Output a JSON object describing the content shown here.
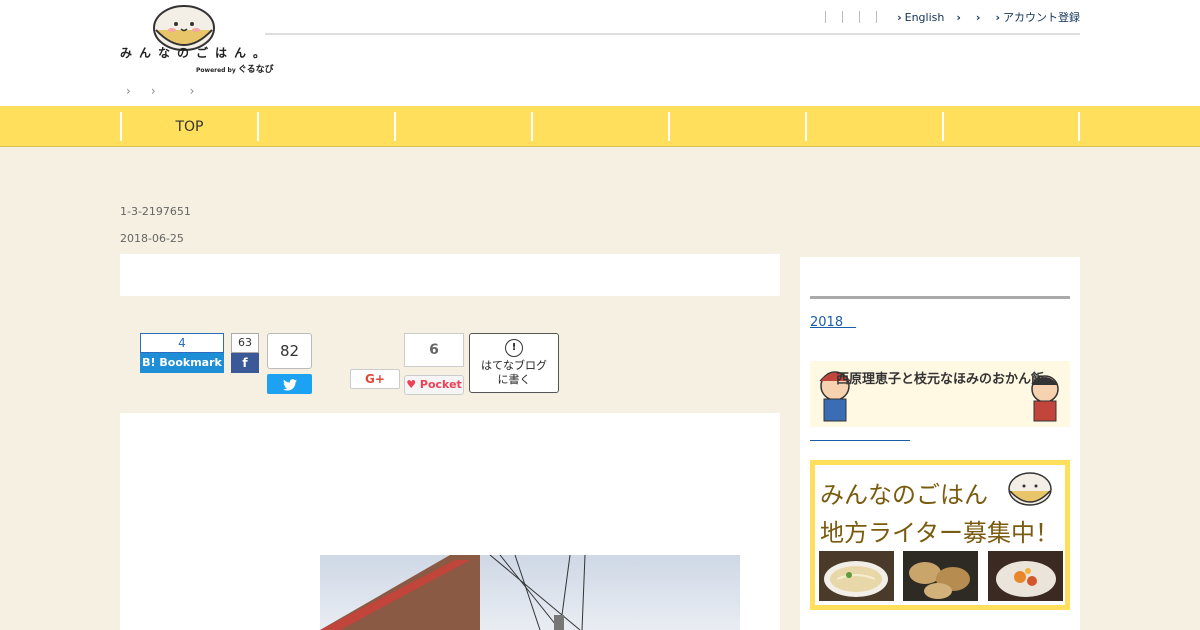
{
  "header": {
    "logo_text": "みんなのごはん。",
    "powered_prefix": "Powered by",
    "powered_brand": "ぐるなび",
    "top_links": [
      "English",
      "",
      "",
      "アカウント登録"
    ],
    "breadcrumb_arrows": [
      "›",
      "›",
      "›"
    ]
  },
  "nav": {
    "items": [
      "TOP",
      "",
      "",
      "",
      "",
      "",
      ""
    ]
  },
  "article": {
    "id": "1-3-2197651",
    "date": "2018-06-25",
    "title": ""
  },
  "share": {
    "hatena_count": "4",
    "hatena_label": "Bookmark",
    "facebook_count": "63",
    "facebook_label": "f",
    "twitter_count": "82",
    "google_label": "G+",
    "pocket_count": "6",
    "pocket_label": "Pocket",
    "hatena_write_label_1": "はてなブログ",
    "hatena_write_label_2": "に書く"
  },
  "sidebar": {
    "link_year": "2018　",
    "banner1_title": "西原理恵子と枝元なほみのおかん飯",
    "banner2_line1": "みんなのごはん",
    "banner2_line2": "地方ライター募集中！"
  },
  "colors": {
    "nav_yellow": "#ffdf5c",
    "page_bg": "#f5f0e1",
    "link_blue": "#1a5ea8"
  }
}
